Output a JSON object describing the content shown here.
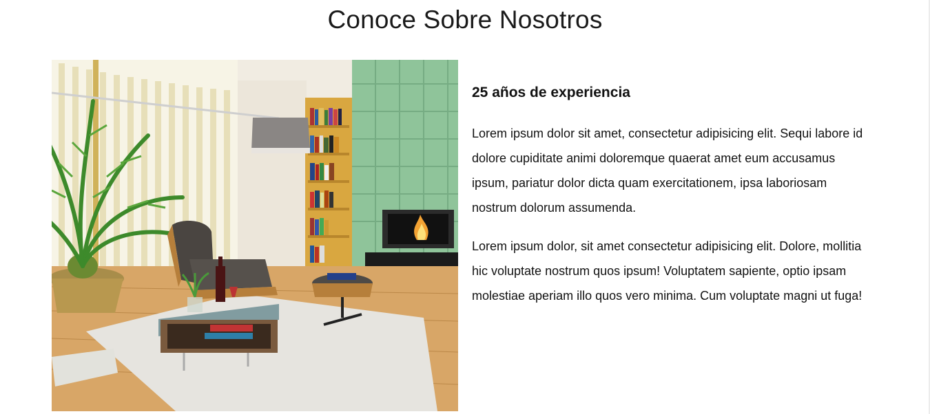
{
  "section": {
    "title": "Conoce Sobre Nosotros"
  },
  "about": {
    "image_icon": "living-room-photo",
    "heading": "25 años de experiencia",
    "paragraphs": [
      "Lorem ipsum dolor sit amet, consectetur adipisicing elit. Sequi labore id dolore cupiditate animi doloremque quaerat amet eum accusamus ipsum, pariatur dolor dicta quam exercitationem, ipsa laboriosam nostrum dolorum assumenda.",
      "Lorem ipsum dolor, sit amet consectetur adipisicing elit. Dolore, mollitia hic voluptate nostrum quos ipsum! Voluptatem sapiente, optio ipsam molestiae aperiam illo quos vero minima. Cum voluptate magni ut fuga!"
    ]
  },
  "colors": {
    "background": "#ffffff",
    "text": "#111111",
    "wall_green": "#8fc49a",
    "wood": "#c9924e"
  }
}
